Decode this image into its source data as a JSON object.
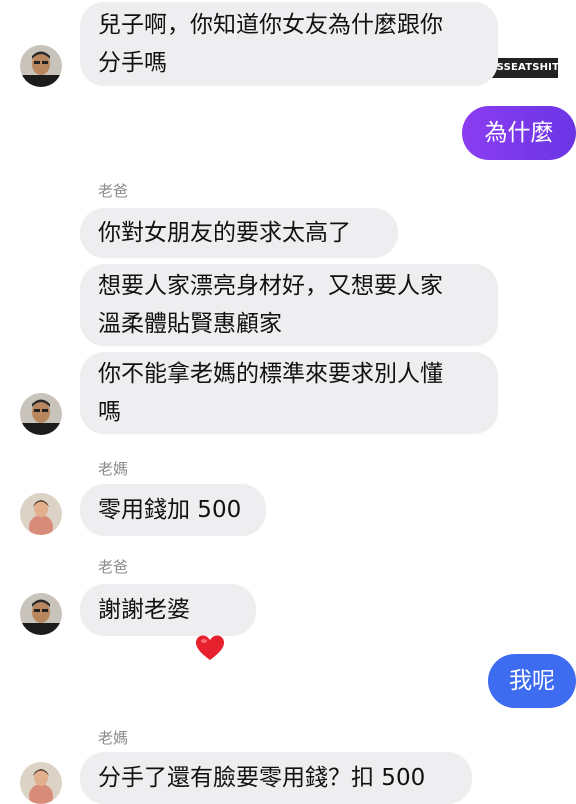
{
  "watermark": "IG@MYBOSSEATSHIT",
  "colors": {
    "outgoing_bubble_start": "#8b3df0",
    "outgoing_bubble_end": "#5f33e0",
    "outgoing_bubble_2": "#3d6cf0",
    "incoming_bubble": "#eeeef0",
    "heart": "#e8212f"
  },
  "messages": {
    "m1": {
      "text": "兒子啊，你知道你女友為什麼跟你\n分手嗎"
    },
    "m2": {
      "text": "為什麼"
    },
    "m3": {
      "sender": "老爸",
      "text": "你對女朋友的要求太高了"
    },
    "m4": {
      "text": "想要人家漂亮身材好，又想要人家\n溫柔體貼賢惠顧家"
    },
    "m5": {
      "text": "你不能拿老媽的標準來要求別人懂\n嗎"
    },
    "m6": {
      "sender": "老媽",
      "text": "零用錢加 500"
    },
    "m7": {
      "sender": "老爸",
      "text": "謝謝老婆",
      "icon": "heart-icon"
    },
    "m8": {
      "text": "我呢"
    },
    "m9": {
      "sender": "老媽",
      "text": "分手了還有臉要零用錢？扣 500"
    }
  }
}
